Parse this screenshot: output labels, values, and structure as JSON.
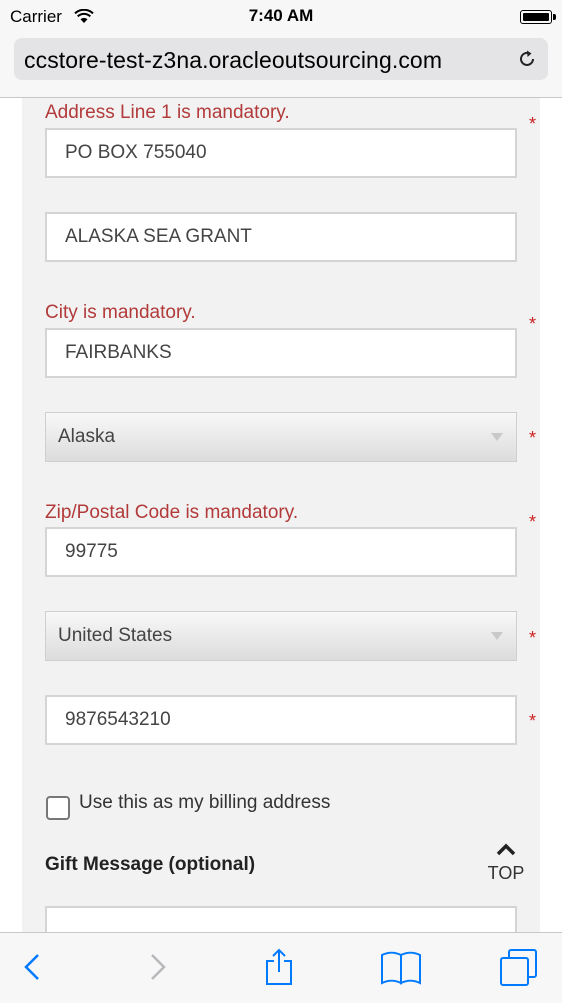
{
  "status_bar": {
    "carrier": "Carrier",
    "time": "7:40 AM"
  },
  "browser": {
    "url": "ccstore-test-z3na.oracleoutsourcing.com"
  },
  "form": {
    "address1_error": "Address Line 1 is mandatory.",
    "address1_value": "PO BOX 755040",
    "address2_value": "ALASKA SEA GRANT",
    "city_error": "City is mandatory.",
    "city_value": "FAIRBANKS",
    "state_value": "Alaska",
    "zip_error": "Zip/Postal Code is mandatory.",
    "zip_value": "99775",
    "country_value": "United States",
    "phone_value": "9876543210",
    "required_marker": "*",
    "billing_checkbox_label": "Use this as my billing address",
    "billing_checked": false,
    "gift_message_title": "Gift Message (optional)",
    "top_label": "TOP"
  },
  "colors": {
    "error": "#b23a3a",
    "required": "#cc2222",
    "link": "#007aff"
  },
  "toolbar": {
    "icons": [
      "back-icon",
      "forward-icon",
      "share-icon",
      "bookmarks-icon",
      "tabs-icon"
    ]
  }
}
